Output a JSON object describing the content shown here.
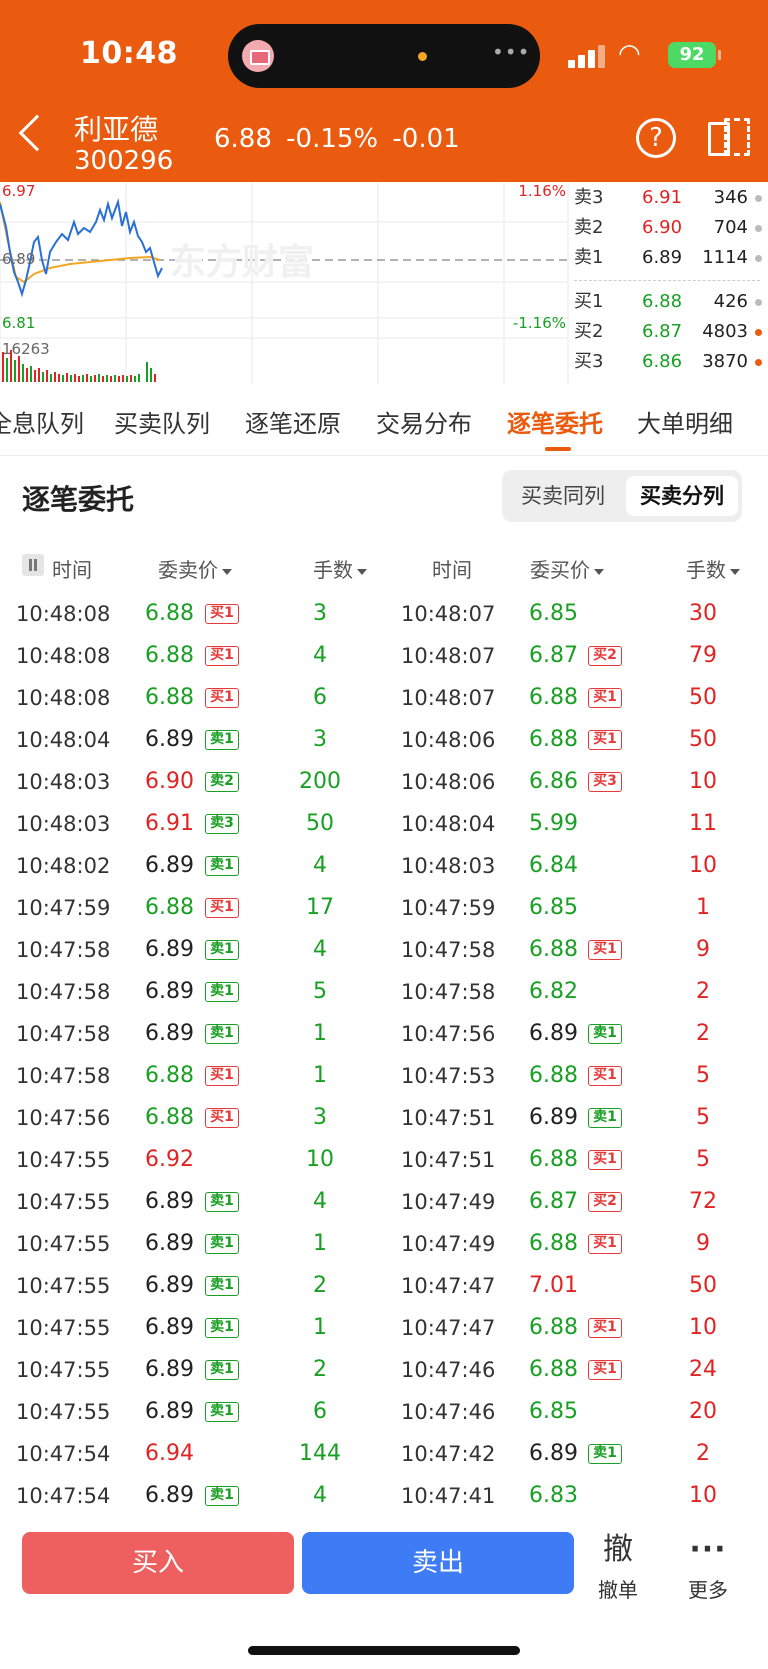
{
  "status_bar": {
    "time": "10:48",
    "battery": "92"
  },
  "header": {
    "stock_name": "利亚德",
    "stock_code": "300296",
    "price": "6.88",
    "change_pct": "-0.15%",
    "change": "-0.01",
    "help": "?"
  },
  "chart": {
    "high_price": "6.97",
    "mid_price": "6.89",
    "low_price": "6.81",
    "high_pct": "1.16%",
    "low_pct": "-1.16%",
    "volume_label": "16263",
    "watermark": "东方财富"
  },
  "orderbook": {
    "asks": [
      {
        "label": "卖3",
        "price": "6.91",
        "vol": "346",
        "color": "#e02424",
        "dot": "#bbbbbb"
      },
      {
        "label": "卖2",
        "price": "6.90",
        "vol": "704",
        "color": "#e02424",
        "dot": "#bbbbbb"
      },
      {
        "label": "卖1",
        "price": "6.89",
        "vol": "1114",
        "color": "#222222",
        "dot": "#bbbbbb"
      }
    ],
    "bids": [
      {
        "label": "买1",
        "price": "6.88",
        "vol": "426",
        "color": "#19a024",
        "dot": "#bbbbbb"
      },
      {
        "label": "买2",
        "price": "6.87",
        "vol": "4803",
        "color": "#19a024",
        "dot": "#ea5a0f"
      },
      {
        "label": "买3",
        "price": "6.86",
        "vol": "3870",
        "color": "#19a024",
        "dot": "#ea5a0f"
      }
    ]
  },
  "tabs": [
    "全息队列",
    "买卖队列",
    "逐笔还原",
    "交易分布",
    "逐笔委托",
    "大单明细"
  ],
  "section": {
    "title": "逐笔委托",
    "seg_same": "买卖同列",
    "seg_split": "买卖分列"
  },
  "columns": {
    "time": "时间",
    "ask_price": "委卖价",
    "qty": "手数",
    "time2": "时间",
    "bid_price": "委买价",
    "qty2": "手数"
  },
  "rows": [
    {
      "lt": "10:48:08",
      "lp": "6.88",
      "lc": "green",
      "ltag": "买1",
      "ltt": "buy",
      "lq": "3",
      "rt": "10:48:07",
      "rp": "6.85",
      "rc": "green",
      "rtag": "",
      "rtt": "",
      "rq": "30"
    },
    {
      "lt": "10:48:08",
      "lp": "6.88",
      "lc": "green",
      "ltag": "买1",
      "ltt": "buy",
      "lq": "4",
      "rt": "10:48:07",
      "rp": "6.87",
      "rc": "green",
      "rtag": "买2",
      "rtt": "buy",
      "rq": "79"
    },
    {
      "lt": "10:48:08",
      "lp": "6.88",
      "lc": "green",
      "ltag": "买1",
      "ltt": "buy",
      "lq": "6",
      "rt": "10:48:07",
      "rp": "6.88",
      "rc": "green",
      "rtag": "买1",
      "rtt": "buy",
      "rq": "50"
    },
    {
      "lt": "10:48:04",
      "lp": "6.89",
      "lc": "black",
      "ltag": "卖1",
      "ltt": "sell",
      "lq": "3",
      "rt": "10:48:06",
      "rp": "6.88",
      "rc": "green",
      "rtag": "买1",
      "rtt": "buy",
      "rq": "50"
    },
    {
      "lt": "10:48:03",
      "lp": "6.90",
      "lc": "red",
      "ltag": "卖2",
      "ltt": "sell",
      "lq": "200",
      "rt": "10:48:06",
      "rp": "6.86",
      "rc": "green",
      "rtag": "买3",
      "rtt": "buy",
      "rq": "10"
    },
    {
      "lt": "10:48:03",
      "lp": "6.91",
      "lc": "red",
      "ltag": "卖3",
      "ltt": "sell",
      "lq": "50",
      "rt": "10:48:04",
      "rp": "5.99",
      "rc": "green",
      "rtag": "",
      "rtt": "",
      "rq": "11"
    },
    {
      "lt": "10:48:02",
      "lp": "6.89",
      "lc": "black",
      "ltag": "卖1",
      "ltt": "sell",
      "lq": "4",
      "rt": "10:48:03",
      "rp": "6.84",
      "rc": "green",
      "rtag": "",
      "rtt": "",
      "rq": "10"
    },
    {
      "lt": "10:47:59",
      "lp": "6.88",
      "lc": "green",
      "ltag": "买1",
      "ltt": "buy",
      "lq": "17",
      "rt": "10:47:59",
      "rp": "6.85",
      "rc": "green",
      "rtag": "",
      "rtt": "",
      "rq": "1"
    },
    {
      "lt": "10:47:58",
      "lp": "6.89",
      "lc": "black",
      "ltag": "卖1",
      "ltt": "sell",
      "lq": "4",
      "rt": "10:47:58",
      "rp": "6.88",
      "rc": "green",
      "rtag": "买1",
      "rtt": "buy",
      "rq": "9"
    },
    {
      "lt": "10:47:58",
      "lp": "6.89",
      "lc": "black",
      "ltag": "卖1",
      "ltt": "sell",
      "lq": "5",
      "rt": "10:47:58",
      "rp": "6.82",
      "rc": "green",
      "rtag": "",
      "rtt": "",
      "rq": "2"
    },
    {
      "lt": "10:47:58",
      "lp": "6.89",
      "lc": "black",
      "ltag": "卖1",
      "ltt": "sell",
      "lq": "1",
      "rt": "10:47:56",
      "rp": "6.89",
      "rc": "black",
      "rtag": "卖1",
      "rtt": "sell",
      "rq": "2"
    },
    {
      "lt": "10:47:58",
      "lp": "6.88",
      "lc": "green",
      "ltag": "买1",
      "ltt": "buy",
      "lq": "1",
      "rt": "10:47:53",
      "rp": "6.88",
      "rc": "green",
      "rtag": "买1",
      "rtt": "buy",
      "rq": "5"
    },
    {
      "lt": "10:47:56",
      "lp": "6.88",
      "lc": "green",
      "ltag": "买1",
      "ltt": "buy",
      "lq": "3",
      "rt": "10:47:51",
      "rp": "6.89",
      "rc": "black",
      "rtag": "卖1",
      "rtt": "sell",
      "rq": "5"
    },
    {
      "lt": "10:47:55",
      "lp": "6.92",
      "lc": "red",
      "ltag": "",
      "ltt": "",
      "lq": "10",
      "rt": "10:47:51",
      "rp": "6.88",
      "rc": "green",
      "rtag": "买1",
      "rtt": "buy",
      "rq": "5"
    },
    {
      "lt": "10:47:55",
      "lp": "6.89",
      "lc": "black",
      "ltag": "卖1",
      "ltt": "sell",
      "lq": "4",
      "rt": "10:47:49",
      "rp": "6.87",
      "rc": "green",
      "rtag": "买2",
      "rtt": "buy",
      "rq": "72"
    },
    {
      "lt": "10:47:55",
      "lp": "6.89",
      "lc": "black",
      "ltag": "卖1",
      "ltt": "sell",
      "lq": "1",
      "rt": "10:47:49",
      "rp": "6.88",
      "rc": "green",
      "rtag": "买1",
      "rtt": "buy",
      "rq": "9"
    },
    {
      "lt": "10:47:55",
      "lp": "6.89",
      "lc": "black",
      "ltag": "卖1",
      "ltt": "sell",
      "lq": "2",
      "rt": "10:47:47",
      "rp": "7.01",
      "rc": "red",
      "rtag": "",
      "rtt": "",
      "rq": "50"
    },
    {
      "lt": "10:47:55",
      "lp": "6.89",
      "lc": "black",
      "ltag": "卖1",
      "ltt": "sell",
      "lq": "1",
      "rt": "10:47:47",
      "rp": "6.88",
      "rc": "green",
      "rtag": "买1",
      "rtt": "buy",
      "rq": "10"
    },
    {
      "lt": "10:47:55",
      "lp": "6.89",
      "lc": "black",
      "ltag": "卖1",
      "ltt": "sell",
      "lq": "2",
      "rt": "10:47:46",
      "rp": "6.88",
      "rc": "green",
      "rtag": "买1",
      "rtt": "buy",
      "rq": "24"
    },
    {
      "lt": "10:47:55",
      "lp": "6.89",
      "lc": "black",
      "ltag": "卖1",
      "ltt": "sell",
      "lq": "6",
      "rt": "10:47:46",
      "rp": "6.85",
      "rc": "green",
      "rtag": "",
      "rtt": "",
      "rq": "20"
    },
    {
      "lt": "10:47:54",
      "lp": "6.94",
      "lc": "red",
      "ltag": "",
      "ltt": "",
      "lq": "144",
      "rt": "10:47:42",
      "rp": "6.89",
      "rc": "black",
      "rtag": "卖1",
      "rtt": "sell",
      "rq": "2"
    },
    {
      "lt": "10:47:54",
      "lp": "6.89",
      "lc": "black",
      "ltag": "卖1",
      "ltt": "sell",
      "lq": "4",
      "rt": "10:47:41",
      "rp": "6.83",
      "rc": "green",
      "rtag": "",
      "rtt": "",
      "rq": "10"
    }
  ],
  "bottom": {
    "buy": "买入",
    "sell": "卖出",
    "cancel_icon": "撤",
    "cancel": "撤单",
    "more_icon": "···",
    "more": "更多"
  },
  "colors": {
    "brand": "#ea5a0f",
    "up": "#e02424",
    "down": "#19a024",
    "buy_button": "#ee6060",
    "sell_button": "#3d7cf4"
  }
}
